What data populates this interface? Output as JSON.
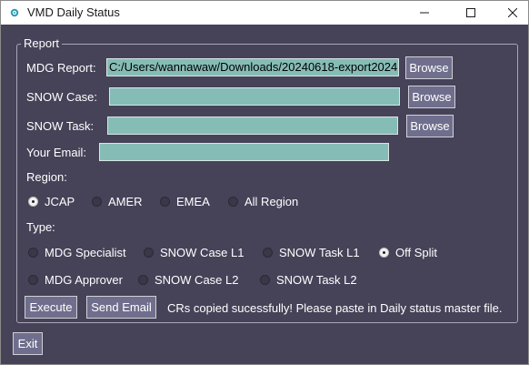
{
  "window": {
    "title": "VMD Daily Status"
  },
  "report": {
    "frame_label": "Report",
    "mdg_report_label": "MDG Report:",
    "mdg_report_value": "C:/Users/wannawaw/Downloads/20240618-export2024(",
    "snow_case_label": "SNOW Case:",
    "snow_case_value": "",
    "snow_task_label": "SNOW Task:",
    "snow_task_value": "",
    "email_label": "Your Email:",
    "email_value": "",
    "browse_label": "Browse"
  },
  "region": {
    "label": "Region:",
    "options": [
      "JCAP",
      "AMER",
      "EMEA",
      "All Region"
    ],
    "selected": "JCAP"
  },
  "type": {
    "label": "Type:",
    "row1": [
      "MDG Specialist",
      "SNOW Case L1",
      "SNOW Task L1",
      "Off Split"
    ],
    "row2": [
      "MDG Approver",
      "SNOW Case L2",
      "SNOW Task L2"
    ],
    "selected": "Off Split"
  },
  "actions": {
    "execute_label": "Execute",
    "send_email_label": "Send Email",
    "status_message": "CRs copied sucessfully! Please paste in Daily status master file.",
    "exit_label": "Exit"
  },
  "icons": {
    "app": "app-icon",
    "minimize": "minimize-icon",
    "maximize": "maximize-icon",
    "close": "close-icon"
  },
  "colors": {
    "background": "#464258",
    "field": "#86bcb6",
    "button": "#6f6e8c"
  }
}
